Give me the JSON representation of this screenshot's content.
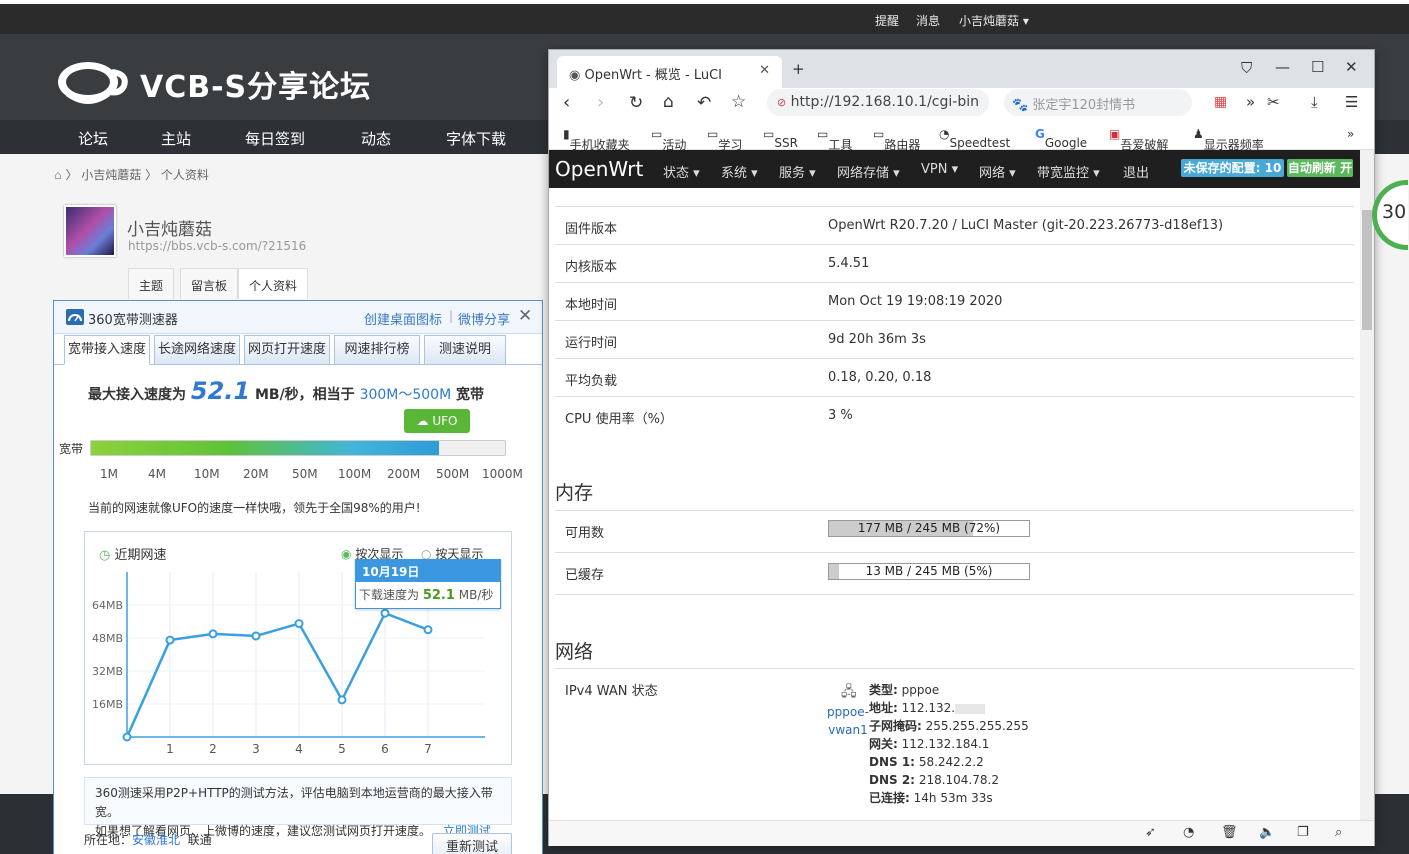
{
  "forum": {
    "top_links": [
      "提醒",
      "消息",
      "小吉炖蘑菇 ▾"
    ],
    "logo_text": "VCB-S分享论坛",
    "nav": [
      "论坛",
      "主站",
      "每日签到",
      "动态",
      "字体下载"
    ],
    "breadcrumb": "小吉炖蘑菇 〉 个人资料",
    "user_name": "小吉炖蘑菇",
    "user_url": "https://bbs.vcb-s.com/?21516",
    "tabs": [
      "主题",
      "留言板",
      "个人资料"
    ]
  },
  "speedtest": {
    "title": "360宽带测速器",
    "link_create": "创建桌面图标",
    "link_weibo": "微博分享",
    "tabs": [
      "宽带接入速度",
      "长途网络速度",
      "网页打开速度",
      "网速排行榜",
      "测速说明"
    ],
    "speed_prefix": "最大接入速度为",
    "speed_value": "52.1",
    "speed_unit": "MB/秒，相当于",
    "equivalent": "300M～500M",
    "equiv_suffix": "宽带",
    "ufo_label": "UFO",
    "bar_label": "宽带",
    "bar_progress": 0.84,
    "ticks": [
      "1M",
      "4M",
      "10M",
      "20M",
      "50M",
      "100M",
      "200M",
      "500M",
      "1000M"
    ],
    "description": "当前的网速就像UFO的速度一样快哦，领先于全国98%的用户!",
    "chart_title": "近期网速",
    "radio_1": "按次显示",
    "radio_2": "按天显示",
    "tooltip_date": "10月19日",
    "tooltip_prefix": "下载速度为",
    "tooltip_value": "52.1",
    "tooltip_unit": "MB/秒",
    "note_line1": "360测速采用P2P+HTTP的测试方法，评估电脑到本地运营商的最大接入带宽。",
    "note_line2": "如果想了解看网页、上微博的速度，建议您测试网页打开速度。",
    "note_link": "立即测试",
    "location_label": "所在地：",
    "location_value": "安徽淮北",
    "isp": "联通",
    "retest": "重新测试"
  },
  "chart_data": {
    "type": "line",
    "title": "近期网速",
    "x": [
      1,
      2,
      3,
      4,
      5,
      6,
      7
    ],
    "series": [
      {
        "values": [
          47,
          50,
          49,
          55,
          18,
          60,
          52
        ]
      }
    ],
    "y_ticks": [
      "16MB",
      "32MB",
      "48MB",
      "64MB"
    ],
    "ylim": [
      0,
      80
    ],
    "grid": true,
    "line_color": "#3a9fe0"
  },
  "browser": {
    "tab_title": "OpenWrt - 概览 - LuCI",
    "url": "http://192.168.10.1/cgi-bin",
    "search_placeholder": "张定宇120封情书",
    "bookmarks": [
      "手机收藏夹",
      "活动",
      "学习",
      "SSR",
      "工具",
      "路由器",
      "Speedtest",
      "Google",
      "吾爱破解",
      "显示器频率"
    ],
    "more": "»"
  },
  "luci": {
    "brand": "OpenWrt",
    "menu": [
      "状态 ▾",
      "系统 ▾",
      "服务 ▾",
      "网络存储 ▾",
      "VPN ▾",
      "网络 ▾",
      "带宽监控 ▾",
      "退出"
    ],
    "unsaved": "未保存的配置: 10",
    "autorefresh": "自动刷新 开",
    "rows": [
      {
        "k": "固件版本",
        "v": "OpenWrt R20.7.20 / LuCI Master (git-20.223.26773-d18ef13)"
      },
      {
        "k": "内核版本",
        "v": "5.4.51"
      },
      {
        "k": "本地时间",
        "v": "Mon Oct 19 19:08:19 2020"
      },
      {
        "k": "运行时间",
        "v": "9d 20h 36m 3s"
      },
      {
        "k": "平均负载",
        "v": "0.18, 0.20, 0.18"
      },
      {
        "k": "CPU 使用率（%）",
        "v": "3 %"
      }
    ],
    "memory_title": "内存",
    "mem_avail_label": "可用数",
    "mem_avail": "177 MB / 245 MB (72%)",
    "mem_avail_frac": 0.72,
    "mem_cache_label": "已缓存",
    "mem_cache": "13 MB / 245 MB (5%)",
    "mem_cache_frac": 0.05,
    "network_title": "网络",
    "wan_label": "IPv4 WAN 状态",
    "iface_line1": "pppoe-",
    "iface_line2": "vwan1",
    "wan": [
      {
        "k": "类型:",
        "v": "pppoe"
      },
      {
        "k": "地址:",
        "v": "112.132."
      },
      {
        "k": "子网掩码:",
        "v": "255.255.255.255"
      },
      {
        "k": "网关:",
        "v": "112.132.184.1"
      },
      {
        "k": "DNS 1:",
        "v": "58.242.2.2"
      },
      {
        "k": "DNS 2:",
        "v": "218.104.78.2"
      },
      {
        "k": "已连接:",
        "v": "14h 53m 33s"
      }
    ]
  },
  "side_badge": "30"
}
